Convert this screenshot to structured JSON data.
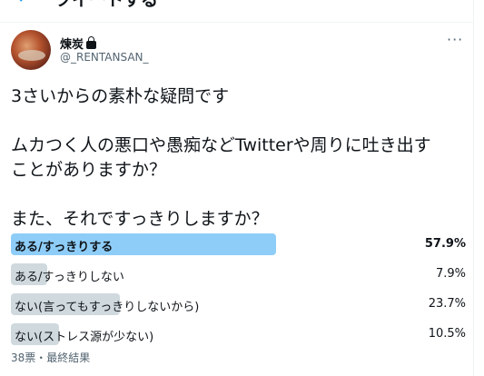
{
  "header": {
    "back_icon": "arrow-left-icon",
    "title": "ツイートする"
  },
  "author": {
    "name": "煉炭",
    "handle": "@_RENTANSAN_",
    "protected_icon": "lock-icon"
  },
  "tweet": {
    "lines": [
      "3さいからの素朴な疑問です",
      "",
      "ムカつく人の悪口や愚痴などTwitterや周りに吐き出す",
      "ことがありますか？",
      "",
      "また、それですっきりしますか？"
    ]
  },
  "poll": {
    "options": [
      {
        "label": "ある/すっきりする",
        "percent": "57.9%",
        "value": 57.9,
        "winner": true
      },
      {
        "label": "ある/すっきりしない",
        "percent": "7.9%",
        "value": 7.9,
        "winner": false
      },
      {
        "label": "ない(言ってもすっきりしないから)",
        "percent": "23.7%",
        "value": 23.7,
        "winner": false
      },
      {
        "label": "ない(ストレス源が少ない)",
        "percent": "10.5%",
        "value": 10.5,
        "winner": false
      }
    ],
    "meta": "38票・最終結果"
  },
  "colors": {
    "winner_bar": "#8ecdf8",
    "other_bar": "#cfd9de",
    "accent": "#1d9bf0"
  }
}
